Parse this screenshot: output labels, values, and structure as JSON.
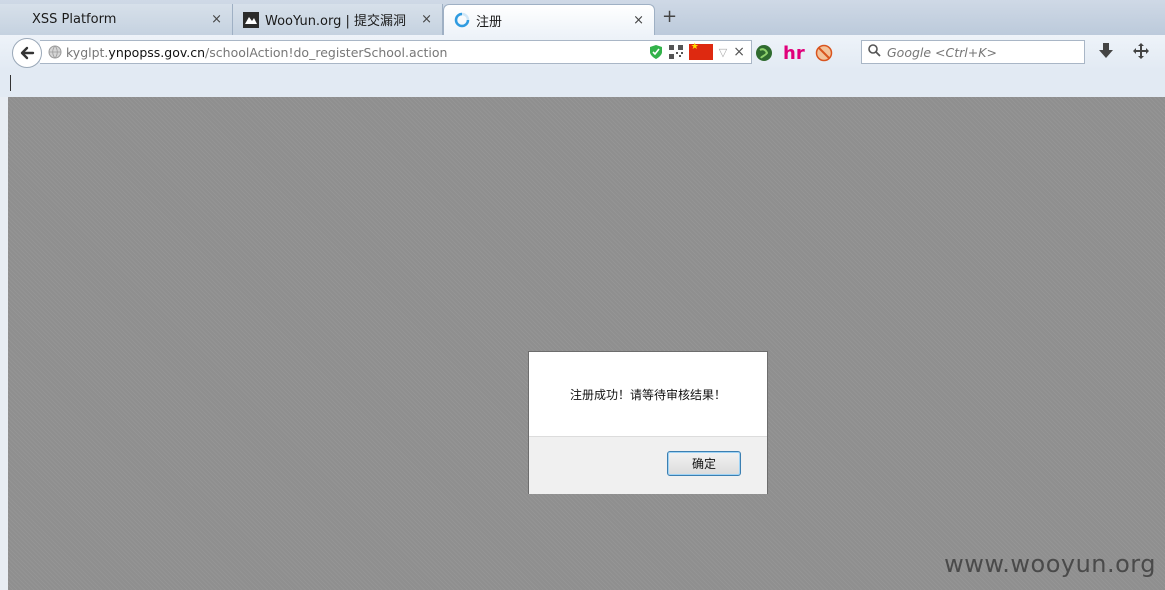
{
  "tabs": [
    {
      "title": "XSS Platform",
      "close": "×"
    },
    {
      "title": "WooYun.org | 提交漏洞",
      "close": "×"
    },
    {
      "title": "注册",
      "close": "×"
    }
  ],
  "new_tab": "+",
  "url": {
    "prefix": "kyglpt.",
    "host": "ynpopss.gov.cn",
    "path": "/schoolAction!do_registerSchool.action"
  },
  "url_close": "×",
  "url_dropdown": "▽",
  "search": {
    "placeholder": "Google <Ctrl+K>"
  },
  "toolbar": {
    "hr_icon": {
      "h": "h",
      "r": "r"
    }
  },
  "dialog": {
    "message": "注册成功！请等待审核结果！",
    "ok_label": "确定"
  },
  "watermark": "www.wooyun.org",
  "colors": {
    "accent_flag": "#de2910",
    "shield": "#33b24a",
    "hr_pink": "#e0007a"
  }
}
